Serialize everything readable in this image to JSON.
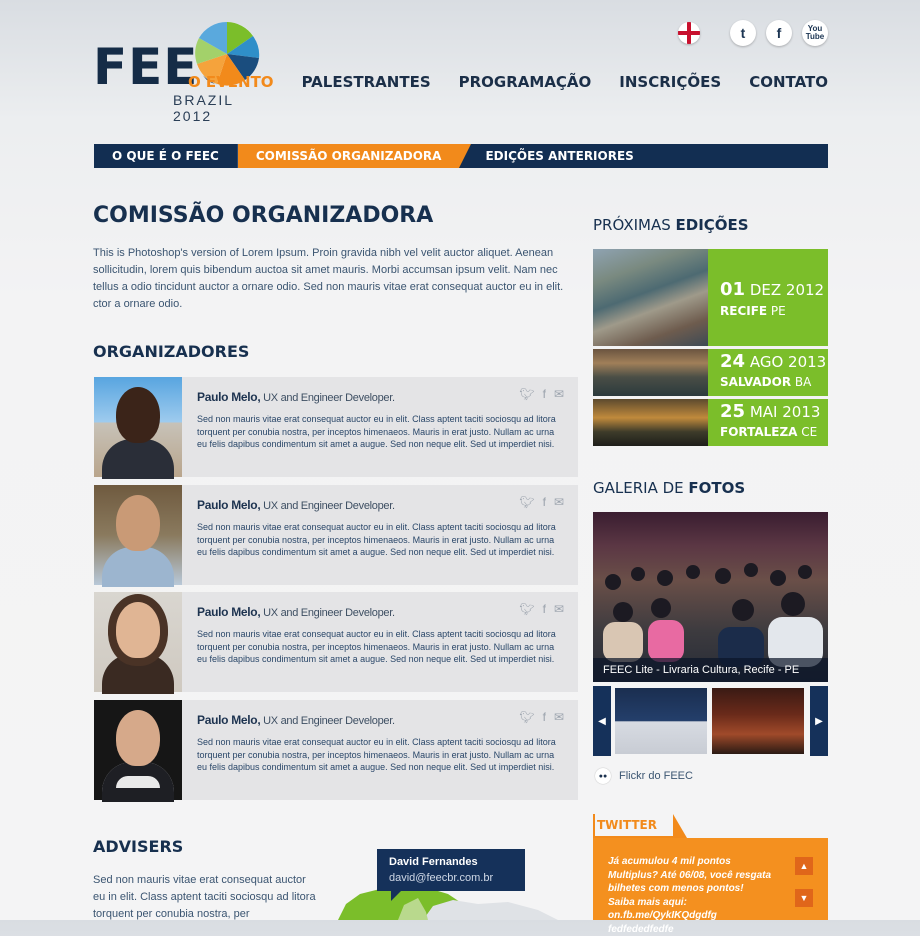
{
  "logo": {
    "text": "FEEC",
    "sub": "BRAZIL 2012"
  },
  "social_top": {
    "twitter": "t",
    "facebook": "f",
    "youtube": "You Tube"
  },
  "nav": [
    "O EVENTO",
    "PALESTRANTES",
    "PROGRAMAÇÃO",
    "INSCRIÇÕES",
    "CONTATO"
  ],
  "subnav": [
    "O QUE É O FEEC",
    "COMISSÃO ORGANIZADORA",
    "EDIÇÕES ANTERIORES"
  ],
  "page": {
    "title": "COMISSÃO ORGANIZADORA",
    "intro": "This is Photoshop's version  of Lorem Ipsum. Proin gravida nibh vel velit auctor aliquet. Aenean sollicitudin, lorem quis bibendum auctoa sit amet mauris. Morbi accumsan ipsum velit. Nam nec tellus a odio tincidunt auctor a ornare odio. Sed non  mauris vitae erat consequat auctor eu in elit. ctor a ornare odio.",
    "organizers_title": "ORGANIZADORES",
    "advisers_title": "ADVISERS",
    "advisers_text": "Sed non  mauris vitae erat consequat auctor eu in elit. Class aptent taciti sociosqu ad litora torquent per conubia nostra, per"
  },
  "organizers": [
    {
      "name": "Paulo Melo,",
      "role": " UX and Engineer Developer.",
      "desc": "Sed non  mauris vitae erat consequat auctor eu in elit. Class aptent taciti sociosqu ad litora torquent per conubia nostra, per inceptos himenaeos. Mauris in erat justo. Nullam ac urna eu felis dapibus condimentum sit amet a augue. Sed non neque elit. Sed ut imperdiet nisi."
    },
    {
      "name": "Paulo Melo,",
      "role": " UX and Engineer Developer.",
      "desc": "Sed non  mauris vitae erat consequat auctor eu in elit. Class aptent taciti sociosqu ad litora torquent per conubia nostra, per inceptos himenaeos. Mauris in erat justo. Nullam ac urna eu felis dapibus condimentum sit amet a augue. Sed non neque elit. Sed ut imperdiet nisi."
    },
    {
      "name": "Paulo Melo,",
      "role": " UX and Engineer Developer.",
      "desc": "Sed non  mauris vitae erat consequat auctor eu in elit. Class aptent taciti sociosqu ad litora torquent per conubia nostra, per inceptos himenaeos. Mauris in erat justo. Nullam ac urna eu felis dapibus condimentum sit amet a augue. Sed non neque elit. Sed ut imperdiet nisi."
    },
    {
      "name": "Paulo Melo,",
      "role": " UX and Engineer Developer.",
      "desc": "Sed non  mauris vitae erat consequat auctor eu in elit. Class aptent taciti sociosqu ad litora torquent per conubia nostra, per inceptos himenaeos. Mauris in erat justo. Nullam ac urna eu felis dapibus condimentum sit amet a augue. Sed non neque elit. Sed ut imperdiet nisi."
    }
  ],
  "adviser_tooltip": {
    "name": "David Fernandes",
    "email": "david@feecbr.com.br"
  },
  "next_editions": {
    "title_a": "PRÓXIMAS ",
    "title_b": "EDIÇÕES",
    "items": [
      {
        "day": "01",
        "month": " DEZ 2012",
        "city": "RECIFE",
        "state": " PE"
      },
      {
        "day": "24",
        "month": " AGO 2013",
        "city": "SALVADOR",
        "state": " BA"
      },
      {
        "day": "25",
        "month": " MAI 2013",
        "city": "FORTALEZA",
        "state": " CE"
      }
    ]
  },
  "gallery": {
    "title_a": "GALERIA DE ",
    "title_b": "FOTOS",
    "caption": "FEEC Lite - Livraria Cultura, Recife - PE",
    "prev": "◀",
    "next": "▶",
    "flickr": "Flickr do FEEC"
  },
  "twitter": {
    "title": "TWITTER",
    "text": "Já acumulou 4 mil pontos Multiplus? Até 06/08, você resgata bilhetes com menos pontos! Saiba mais aqui: on.fb.me/QykIKQdgdfg fedfededfedfe",
    "up": "▲",
    "down": "▼"
  },
  "colors": {
    "navy": "#122e52",
    "orange": "#f28a1b",
    "green": "#7bbe2a"
  }
}
